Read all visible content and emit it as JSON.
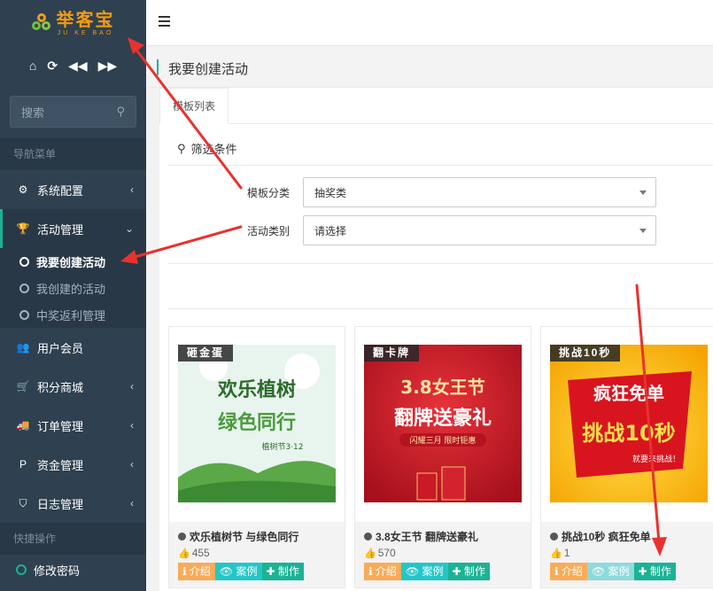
{
  "logo": {
    "main": "举客宝",
    "sub": "JU KE BAO"
  },
  "quick_icons": [
    "home-icon",
    "refresh-icon",
    "backward-icon",
    "forward-icon"
  ],
  "search": {
    "placeholder": "搜索"
  },
  "nav_header": "导航菜单",
  "quick_header": "快捷操作",
  "nav": {
    "system": "系统配置",
    "activity": "活动管理",
    "sub": [
      "我要创建活动",
      "我创建的活动",
      "中奖返利管理"
    ],
    "users": "用户会员",
    "points": "积分商城",
    "orders": "订单管理",
    "funds": "资金管理",
    "logs": "日志管理"
  },
  "change_password": "修改密码",
  "page_title": "我要创建活动",
  "tab_label": "模板列表",
  "filter_title": "筛选条件",
  "filters": {
    "category_label": "模板分类",
    "category_value": "抽奖类",
    "type_label": "活动类别",
    "type_value": "请选择"
  },
  "cards": [
    {
      "badge": "砸金蛋",
      "name": "欢乐植树节 与绿色同行",
      "likes": "455",
      "img_title": "欢乐植树",
      "img_sub": "绿色同行",
      "img_date": "植树节3·12"
    },
    {
      "badge": "翻卡牌",
      "name": "3.8女王节 翻牌送豪礼",
      "likes": "570",
      "img_title": "3.8女王节",
      "img_sub": "翻牌送豪礼",
      "img_date": "闪耀三月 限时钜惠"
    },
    {
      "badge": "挑战10秒",
      "name": "挑战10秒 疯狂免单",
      "likes": "1",
      "img_title": "疯狂免单",
      "img_sub": "挑战10秒",
      "img_date": "就要来挑战！"
    }
  ],
  "buttons": {
    "intro": "介绍",
    "case": "案例",
    "make": "制作"
  },
  "colors": {
    "sidebar": "#2f4050",
    "accent": "#1ab394",
    "orange": "#f8ac59",
    "cyan": "#23c6c8",
    "arrow": "#e8322f"
  }
}
